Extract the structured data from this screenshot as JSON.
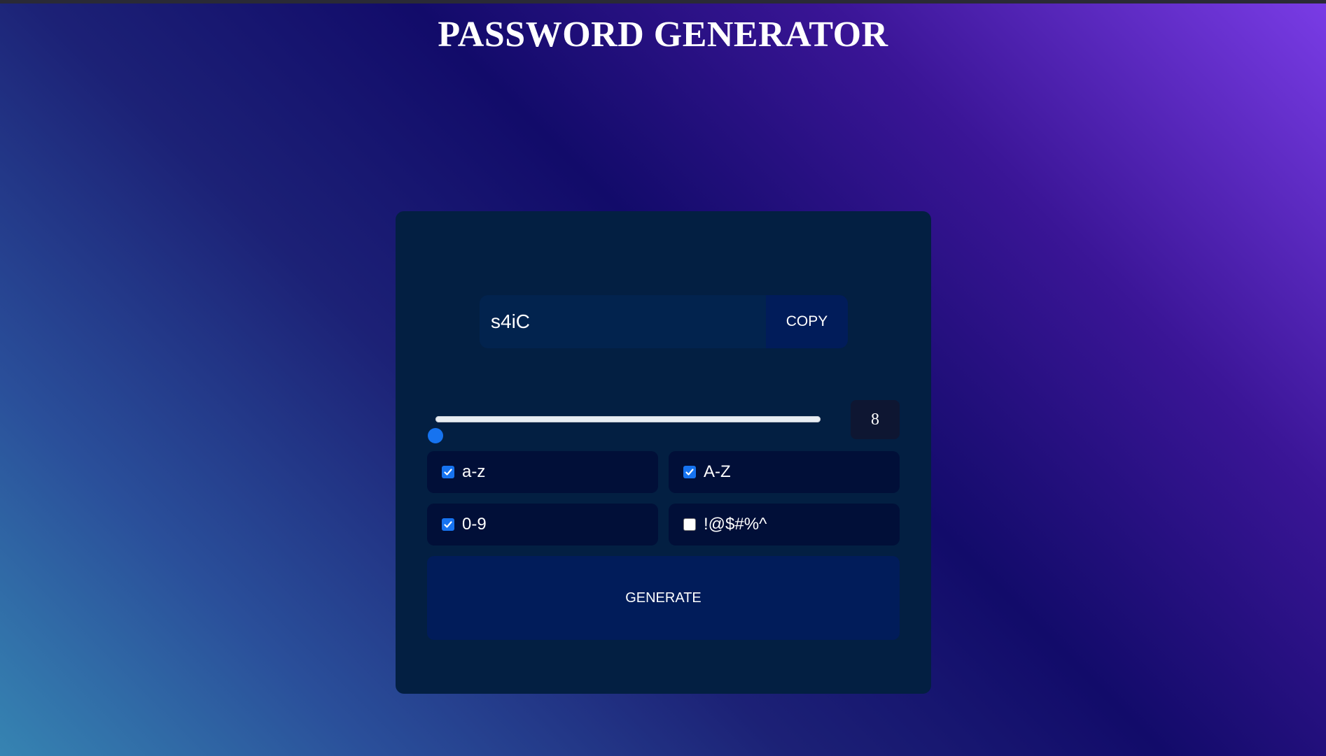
{
  "page": {
    "title": "PASSWORD GENERATOR"
  },
  "generator": {
    "password_value": "s4iC",
    "copy_label": "COPY",
    "length_value": "8",
    "length_fraction": 0.0,
    "options": [
      {
        "label": "a-z",
        "checked": true
      },
      {
        "label": "A-Z",
        "checked": true
      },
      {
        "label": "0-9",
        "checked": true
      },
      {
        "label": "!@$#%^",
        "checked": false
      }
    ],
    "generate_label": "GENERATE"
  },
  "colors": {
    "card_bg": "#031f42",
    "accent": "#1673f0",
    "button_bg": "#011c5a",
    "option_bg": "#010f38"
  }
}
